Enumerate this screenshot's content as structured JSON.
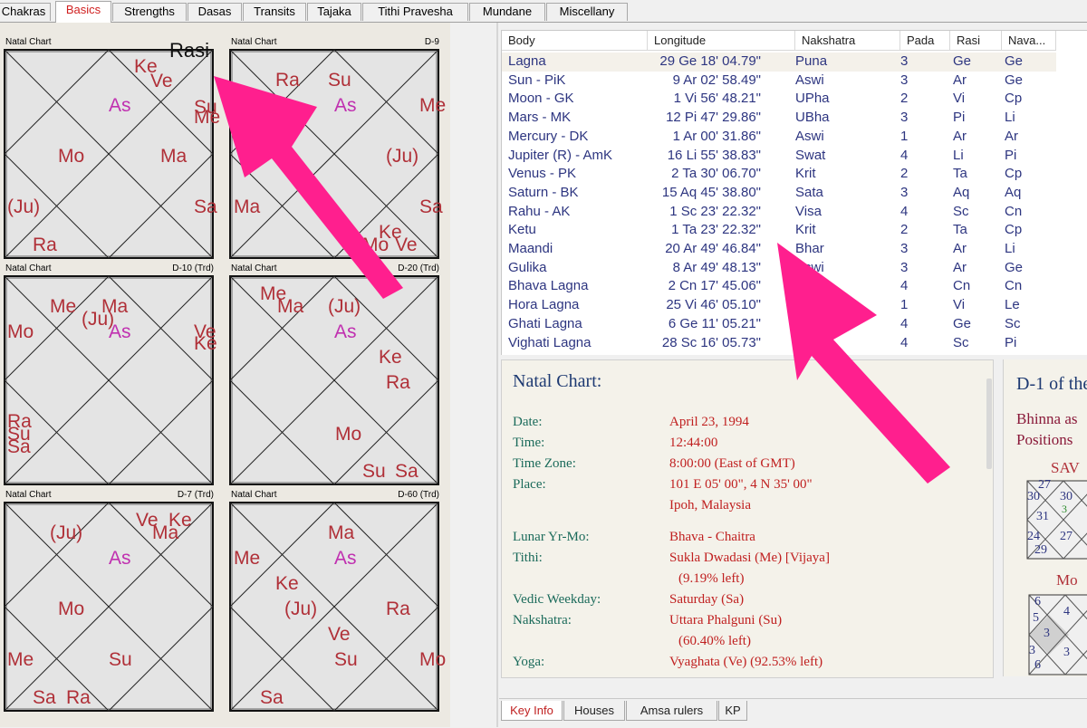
{
  "top_tabs": [
    "Chakras",
    "Basics",
    "Strengths",
    "Dasas",
    "Transits",
    "Tajaka",
    "Tithi Pravesha",
    "Mundane",
    "Miscellany"
  ],
  "active_top_tab": "Basics",
  "rasi_label": "Rasi",
  "charts": [
    {
      "title_left": "Natal Chart",
      "title_right": "D-9"
    },
    {
      "title_left": "Natal Chart",
      "title_right": "D-10 (Trd)"
    },
    {
      "title_left": "Natal Chart",
      "title_right": "D-20 (Trd)"
    },
    {
      "title_left": "Natal Chart",
      "title_right": "D-7 (Trd)"
    },
    {
      "title_left": "Natal Chart",
      "title_right": "D-60 (Trd)"
    }
  ],
  "chart_labels": {
    "rasi": {
      "as": "As",
      "mo": "Mo",
      "ma": "Ma",
      "ju": "(Ju)",
      "ra": "Ra",
      "ke": "Ke",
      "ve": "Ve",
      "su": "Su",
      "me": "Me",
      "sa": "Sa"
    },
    "d9": {
      "ra": "Ra",
      "su": "Su",
      "as": "As",
      "me": "Me",
      "ju": "(Ju)",
      "ma": "Ma",
      "sa": "Sa",
      "ke": "Ke",
      "mo": "Mo",
      "ve": "Ve"
    },
    "d10": {
      "me": "Me",
      "ma": "Ma",
      "ju": "(Ju)",
      "as": "As",
      "mo": "Mo",
      "ve": "Ve",
      "ke": "Ke",
      "ra": "Ra",
      "su": "Su",
      "sa": "Sa"
    },
    "d20": {
      "me": "Me",
      "ma": "Ma",
      "ju": "(Ju)",
      "as": "As",
      "ke": "Ke",
      "ra": "Ra",
      "mo": "Mo",
      "su": "Su",
      "sa": "Sa"
    },
    "d7": {
      "ju": "(Ju)",
      "ve": "Ve",
      "ke": "Ke",
      "ma": "Ma",
      "as": "As",
      "mo": "Mo",
      "me": "Me",
      "su": "Su",
      "sa": "Sa",
      "ra": "Ra"
    },
    "d60": {
      "ma": "Ma",
      "as": "As",
      "me": "Me",
      "ke": "Ke",
      "ju": "(Ju)",
      "ra": "Ra",
      "ve": "Ve",
      "su": "Su",
      "mo": "Mo",
      "sa": "Sa"
    }
  },
  "table": {
    "headers": [
      "Body",
      "Longitude",
      "Nakshatra",
      "Pada",
      "Rasi",
      "Nava..."
    ],
    "rows": [
      [
        "Lagna",
        "29 Ge 18' 04.79\"",
        "Puna",
        "3",
        "Ge",
        "Ge"
      ],
      [
        "Sun - PiK",
        "9 Ar 02' 58.49\"",
        "Aswi",
        "3",
        "Ar",
        "Ge"
      ],
      [
        "Moon - GK",
        "1 Vi 56' 48.21\"",
        "UPha",
        "2",
        "Vi",
        "Cp"
      ],
      [
        "Mars - MK",
        "12 Pi 47' 29.86\"",
        "UBha",
        "3",
        "Pi",
        "Li"
      ],
      [
        "Mercury - DK",
        "1 Ar 00' 31.86\"",
        "Aswi",
        "1",
        "Ar",
        "Ar"
      ],
      [
        "Jupiter (R) - AmK",
        "16 Li 55' 38.83\"",
        "Swat",
        "4",
        "Li",
        "Pi"
      ],
      [
        "Venus - PK",
        "2 Ta 30' 06.70\"",
        "Krit",
        "2",
        "Ta",
        "Cp"
      ],
      [
        "Saturn - BK",
        "15 Aq 45' 38.80\"",
        "Sata",
        "3",
        "Aq",
        "Aq"
      ],
      [
        "Rahu - AK",
        "1 Sc 23' 22.32\"",
        "Visa",
        "4",
        "Sc",
        "Cn"
      ],
      [
        "Ketu",
        "1 Ta 23' 22.32\"",
        "Krit",
        "2",
        "Ta",
        "Cp"
      ],
      [
        "Maandi",
        "20 Ar 49' 46.84\"",
        "Bhar",
        "3",
        "Ar",
        "Li"
      ],
      [
        "Gulika",
        "8 Ar 49' 48.13\"",
        "Aswi",
        "3",
        "Ar",
        "Ge"
      ],
      [
        "Bhava Lagna",
        "2 Cn 17' 45.06\"",
        "",
        "4",
        "Cn",
        "Cn"
      ],
      [
        "Hora Lagna",
        "25 Vi 46' 05.10\"",
        "",
        "1",
        "Vi",
        "Le"
      ],
      [
        "Ghati Lagna",
        "6 Ge 11' 05.21\"",
        "M",
        "4",
        "Ge",
        "Sc"
      ],
      [
        "Vighati Lagna",
        "28 Sc 16' 05.73\"",
        "Jy",
        "4",
        "Sc",
        "Pi"
      ]
    ]
  },
  "info": {
    "title": "Natal Chart:",
    "items": [
      {
        "label": "Date:",
        "value": "April 23, 1994"
      },
      {
        "label": "Time:",
        "value": "12:44:00"
      },
      {
        "label": "Time Zone:",
        "value": "8:00:00 (East of GMT)"
      },
      {
        "label": "Place:",
        "value": "101 E 05' 00\", 4 N 35' 00\""
      },
      {
        "label": "",
        "value": "Ipoh, Malaysia"
      },
      {
        "label": "Lunar Yr-Mo:",
        "value": "Bhava - Chaitra"
      },
      {
        "label": "Tithi:",
        "value": "Sukla Dwadasi (Me) [Vijaya]"
      },
      {
        "label": "",
        "value": "(9.19% left)"
      },
      {
        "label": "Vedic Weekday:",
        "value": "Saturday (Sa)"
      },
      {
        "label": "Nakshatra:",
        "value": "Uttara Phalguni (Su)"
      },
      {
        "label": "",
        "value": "(60.40% left)"
      },
      {
        "label": "Yoga:",
        "value": "Vyaghata (Ve) (92.53% left)"
      }
    ]
  },
  "right_panel": {
    "title": "D-1 of the",
    "line1": "Bhinna as",
    "line2": "Positions",
    "sav_label": "SAV",
    "sav_nums": [
      "27",
      "30",
      "30",
      "31",
      "3",
      "24",
      "27",
      "29"
    ],
    "mo_label": "Mo",
    "mo_nums": [
      "6",
      "4",
      "5",
      "3",
      "3",
      "6",
      "3"
    ]
  },
  "bottom_tabs": [
    "Key Info",
    "Houses",
    "Amsa rulers",
    "KP"
  ],
  "active_bottom_tab": "Key Info",
  "colors": {
    "planet": "#b03038",
    "ascendant": "#c030b0",
    "table_text": "#2d3580",
    "arrow": "#ff1f8e",
    "info_label": "#1a6a5a",
    "info_value": "#c02020"
  }
}
